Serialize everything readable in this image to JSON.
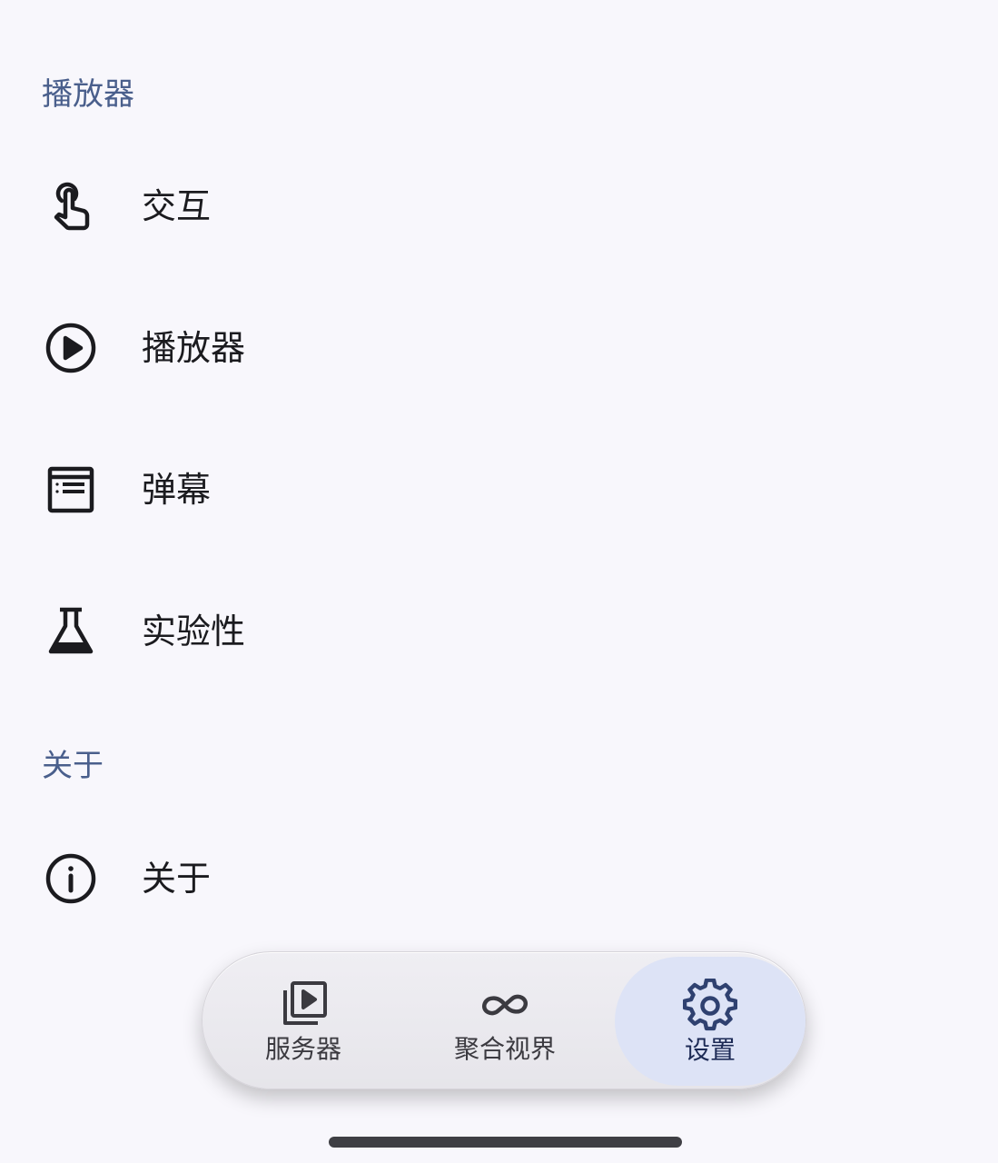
{
  "sections": {
    "player_header": "播放器",
    "about_header": "关于"
  },
  "items": [
    {
      "label": "交互",
      "icon": "touch-gesture-icon"
    },
    {
      "label": "播放器",
      "icon": "play-circle-icon"
    },
    {
      "label": "弹幕",
      "icon": "danmaku-list-icon"
    },
    {
      "label": "实验性",
      "icon": "flask-icon"
    },
    {
      "label": "关于",
      "icon": "info-icon"
    }
  ],
  "nav": {
    "servers_label": "服务器",
    "aggregate_label": "聚合视界",
    "settings_label": "设置",
    "active": "settings"
  },
  "colors": {
    "background": "#f8f7fc",
    "section_header": "#4a5f8c",
    "active_nav": "#dde3f6",
    "active_icon": "#2f4170"
  }
}
